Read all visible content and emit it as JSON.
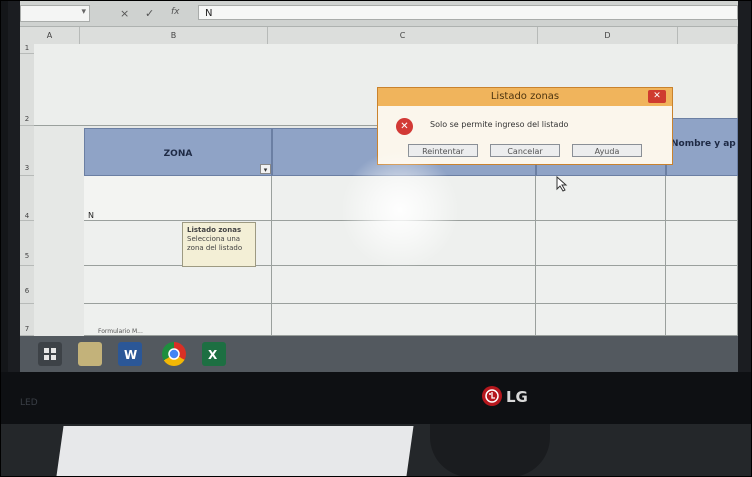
{
  "spreadsheet": {
    "namebox_value": "",
    "cancel_icon": "×",
    "enter_icon": "✓",
    "fx_label": "fx",
    "formula_value": "N",
    "columns": [
      "A",
      "B",
      "C",
      "D"
    ],
    "rows": [
      "1",
      "2",
      "3",
      "4",
      "5",
      "6",
      "7"
    ],
    "header_zona": "ZONA",
    "header_nombre": "Nombre y ap",
    "cell_b4_value": "N",
    "sheet_tab": "Formulario M..."
  },
  "tooltip": {
    "title": "Listado zonas",
    "line1": "Selecciona una",
    "line2": "zona del listado"
  },
  "dialog": {
    "title": "Listado zonas",
    "message": "Solo se permite ingreso del listado",
    "buttons": [
      "Reintentar",
      "Cancelar",
      "Ayuda"
    ],
    "icon": "error-icon"
  },
  "taskbar": {
    "icons": [
      "windows-start-icon",
      "file-explorer-icon",
      "word-icon",
      "chrome-icon",
      "excel-icon"
    ]
  },
  "monitor": {
    "brand": "LG",
    "bezel_label": "LED"
  },
  "colors": {
    "header_blue": "#8fa3c6",
    "dialog_title": "#f0b45c",
    "close_red": "#cf3b2f",
    "taskbar": "#53595f"
  }
}
